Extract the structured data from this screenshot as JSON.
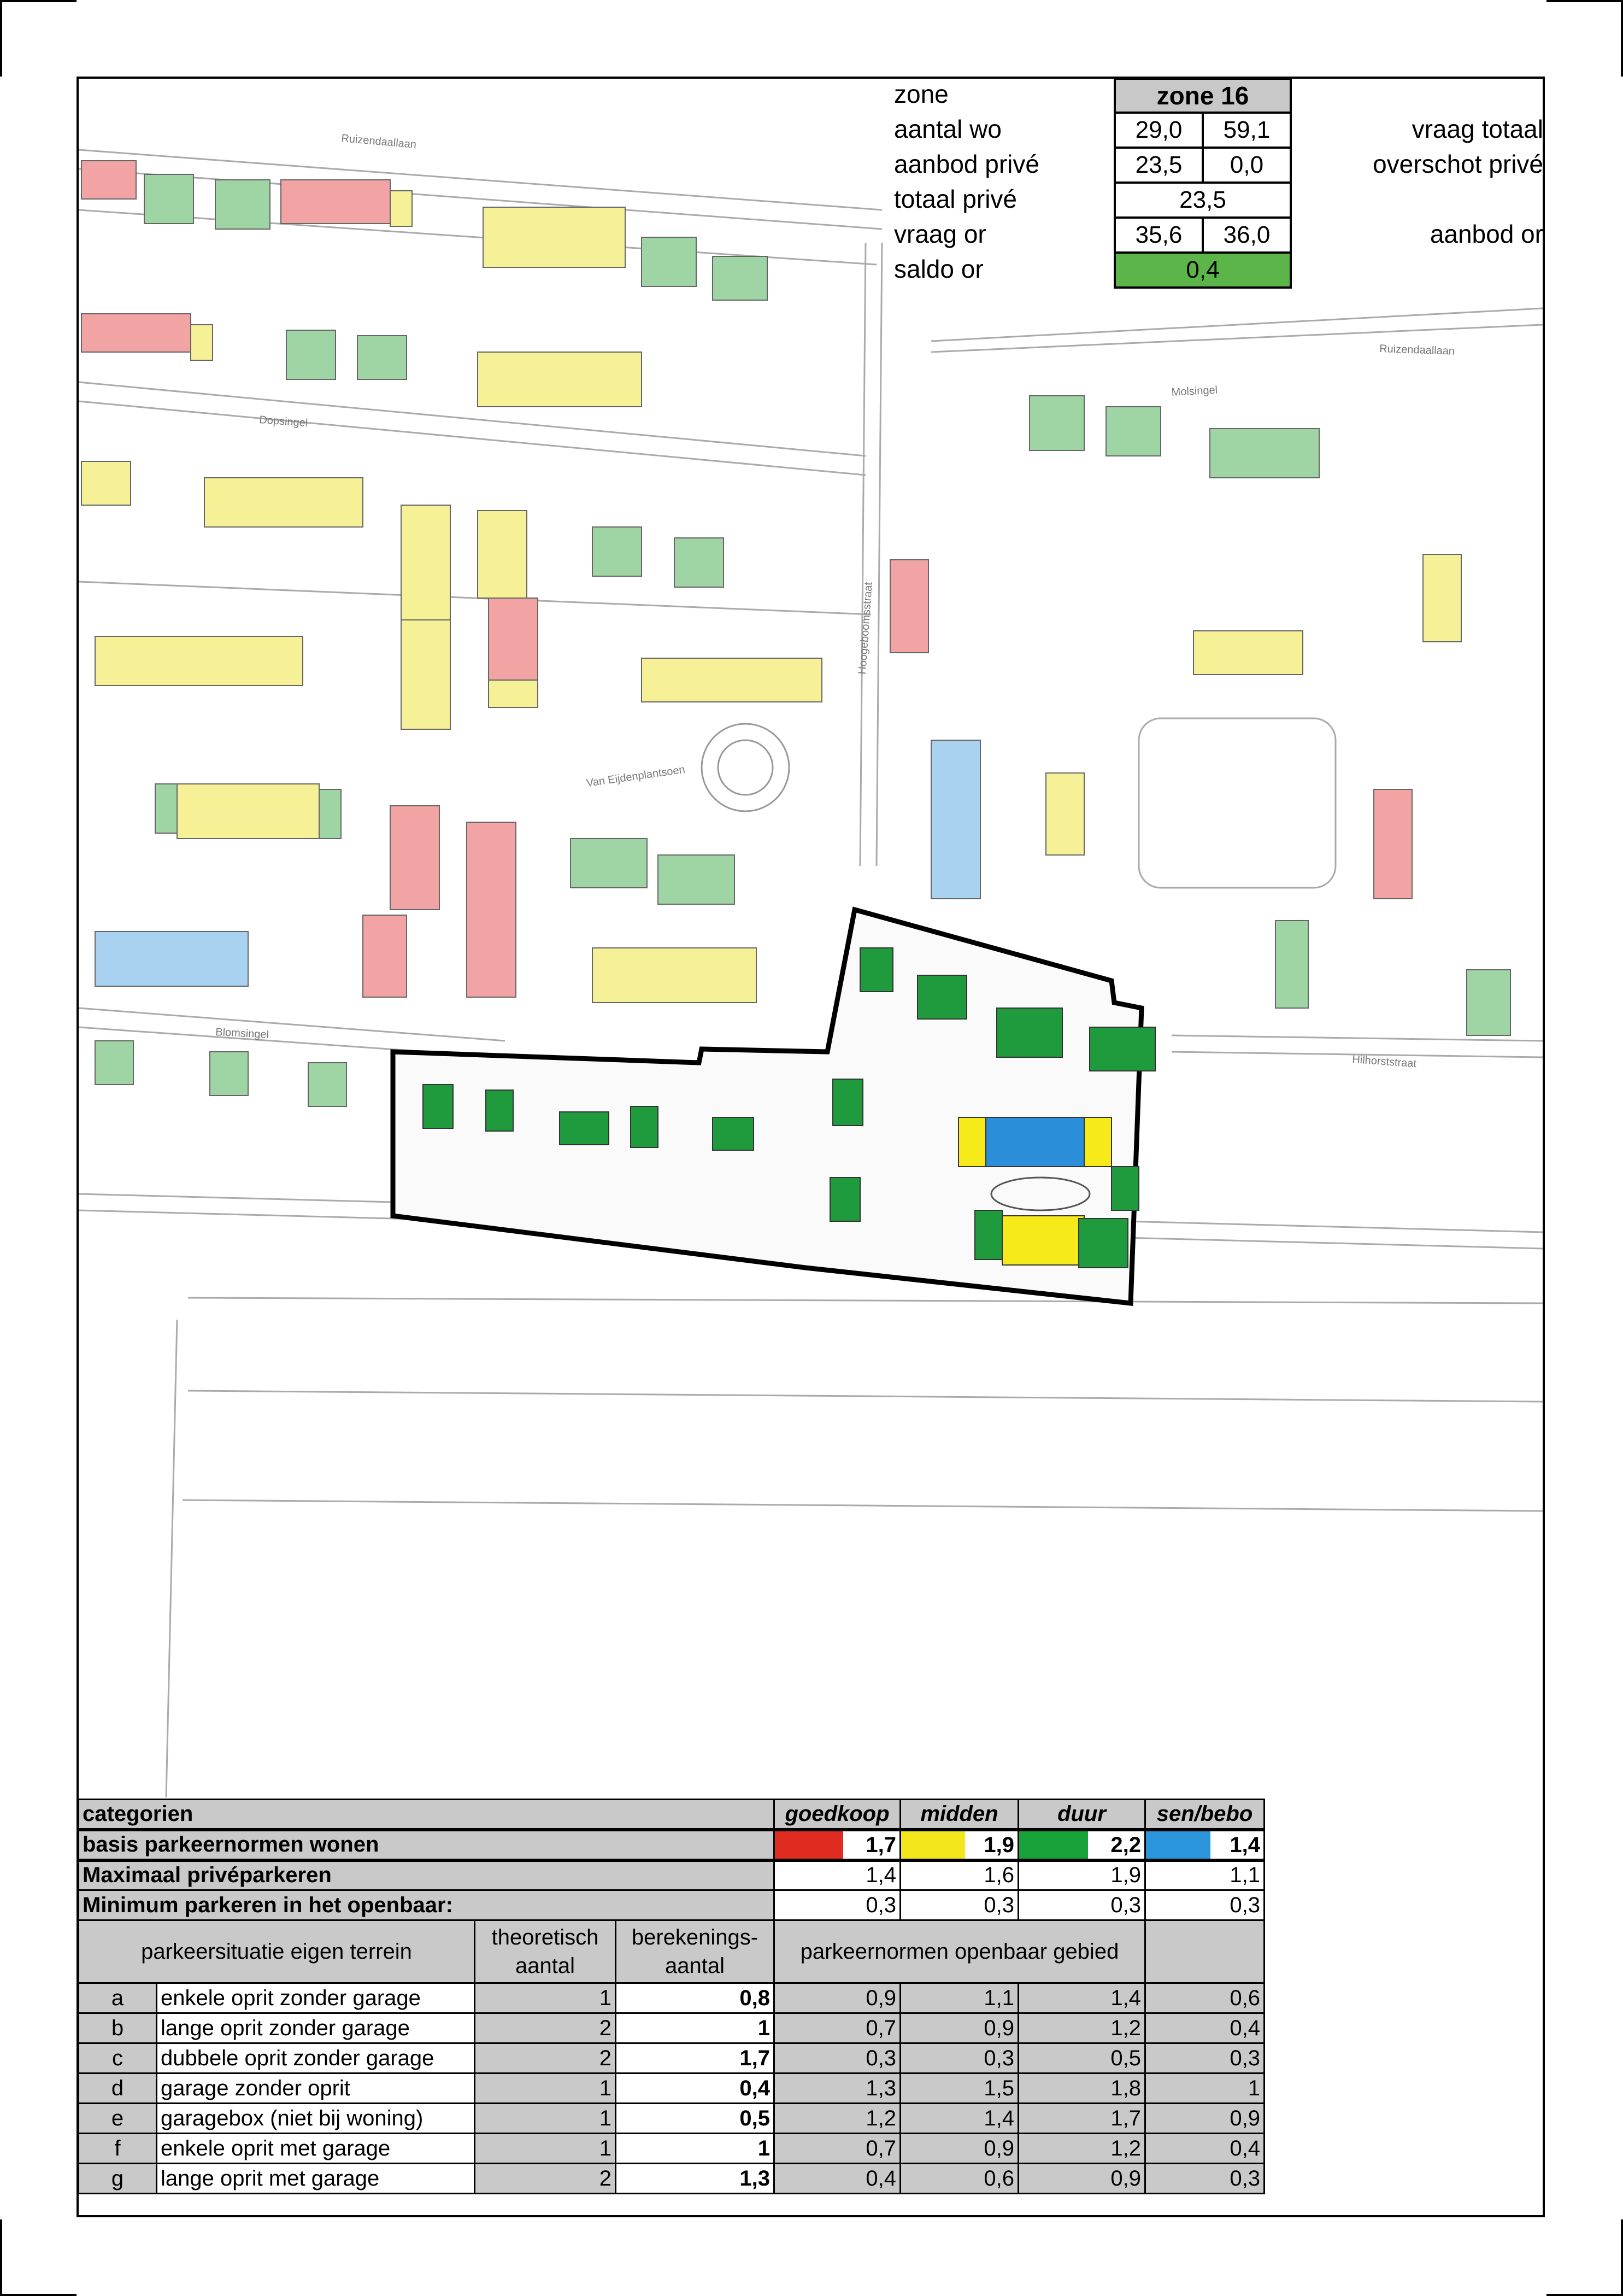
{
  "zone_info": {
    "labels": [
      "zone",
      "aantal wo",
      "aanbod privé",
      "totaal privé",
      "vraag or",
      "saldo or"
    ],
    "right_labels": [
      "vraag totaal",
      "overschot privé",
      "aanbod or"
    ],
    "zone_name": "zone  16",
    "aantal_wo": [
      "29,0",
      "59,1"
    ],
    "aanbod_prive": [
      "23,5",
      "0,0"
    ],
    "totaal_prive": "23,5",
    "vraag_or": [
      "35,6",
      "36,0"
    ],
    "saldo_or": "0,4",
    "saldo_color": "#5cb548"
  },
  "map": {
    "streets": [
      "Ruizendaallaan",
      "Dopsingel",
      "Van Eijdenplantsoen",
      "Blomsingel",
      "Hoogeboomsstraat",
      "Molsingel",
      "Hilhorststraat",
      "Ruizendaallaan"
    ],
    "colors": {
      "goedkoop": "#f2a3a3",
      "midden": "#f6f096",
      "duur": "#9fd4a5",
      "sen_bebo": "#a9d2f0",
      "plan_green": "#1f9a3c",
      "plan_yellow": "#f7ea1a",
      "plan_blue": "#2a8fd8"
    }
  },
  "categories": {
    "header_label": "categorien",
    "columns": [
      "goedkoop",
      "midden",
      "duur",
      "sen/bebo"
    ],
    "column_colors": [
      "#e02b20",
      "#f4e61c",
      "#17a23a",
      "#2b95dc"
    ],
    "basis_label": "basis parkeernormen wonen",
    "basis_values": [
      "1,7",
      "1,9",
      "2,2",
      "1,4"
    ],
    "max_label": "Maximaal privéparkeren",
    "max_values": [
      "1,4",
      "1,6",
      "1,9",
      "1,1"
    ],
    "min_label": "Minimum parkeren in het openbaar:",
    "min_values": [
      "0,3",
      "0,3",
      "0,3",
      "0,3"
    ],
    "sub_header": {
      "situatie": "parkeersituatie eigen terrein",
      "theoretisch": "theoretisch aantal",
      "berekening": "berekenings- aantal",
      "normen": "parkeernormen openbaar gebied"
    },
    "rows": [
      {
        "code": "a",
        "label": "enkele oprit zonder garage",
        "theoretisch": "1",
        "berekening": "0,8",
        "values": [
          "0,9",
          "1,1",
          "1,4",
          "0,6"
        ]
      },
      {
        "code": "b",
        "label": "lange oprit zonder garage",
        "theoretisch": "2",
        "berekening": "1",
        "values": [
          "0,7",
          "0,9",
          "1,2",
          "0,4"
        ]
      },
      {
        "code": "c",
        "label": "dubbele oprit zonder garage",
        "theoretisch": "2",
        "berekening": "1,7",
        "values": [
          "0,3",
          "0,3",
          "0,5",
          "0,3"
        ]
      },
      {
        "code": "d",
        "label": "garage zonder oprit",
        "theoretisch": "1",
        "berekening": "0,4",
        "values": [
          "1,3",
          "1,5",
          "1,8",
          "1"
        ]
      },
      {
        "code": "e",
        "label": "garagebox (niet bij woning)",
        "theoretisch": "1",
        "berekening": "0,5",
        "values": [
          "1,2",
          "1,4",
          "1,7",
          "0,9"
        ]
      },
      {
        "code": "f",
        "label": "enkele oprit met garage",
        "theoretisch": "1",
        "berekening": "1",
        "values": [
          "0,7",
          "0,9",
          "1,2",
          "0,4"
        ]
      },
      {
        "code": "g",
        "label": "lange oprit met garage",
        "theoretisch": "2",
        "berekening": "1,3",
        "values": [
          "0,4",
          "0,6",
          "0,9",
          "0,3"
        ]
      }
    ]
  }
}
